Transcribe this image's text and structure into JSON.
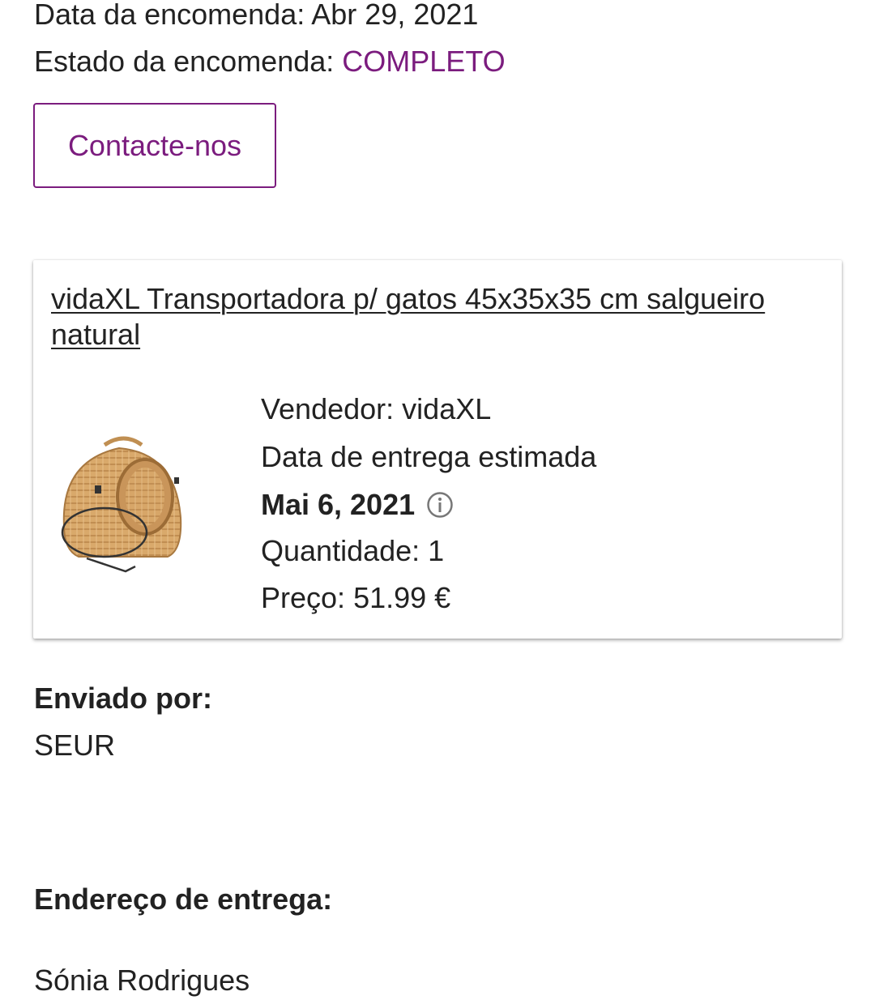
{
  "order": {
    "date_label": "Data da encomenda:",
    "date_value": "Abr 29, 2021",
    "status_label": "Estado da encomenda:",
    "status_value": "COMPLETO",
    "contact_button": "Contacte-nos"
  },
  "product": {
    "title": "vidaXL Transportadora p/ gatos 45x35x35 cm salgueiro natural",
    "image_icon": "wicker-cat-carrier-image",
    "seller_label": "Vendedor:",
    "seller_value": "vidaXL",
    "estimated_delivery_label": "Data de entrega estimada",
    "estimated_delivery_date": "Mai 6, 2021",
    "info_icon": "info-icon",
    "quantity_label": "Quantidade:",
    "quantity_value": "1",
    "price_label": "Preço:",
    "price_value": "51.99 €"
  },
  "shipping": {
    "title": "Enviado por:",
    "carrier": "SEUR"
  },
  "address": {
    "title": "Endereço de entrega:",
    "name": "Sónia Rodrigues"
  },
  "colors": {
    "accent": "#7b1c7e",
    "text": "#222222",
    "background": "#ffffff"
  }
}
